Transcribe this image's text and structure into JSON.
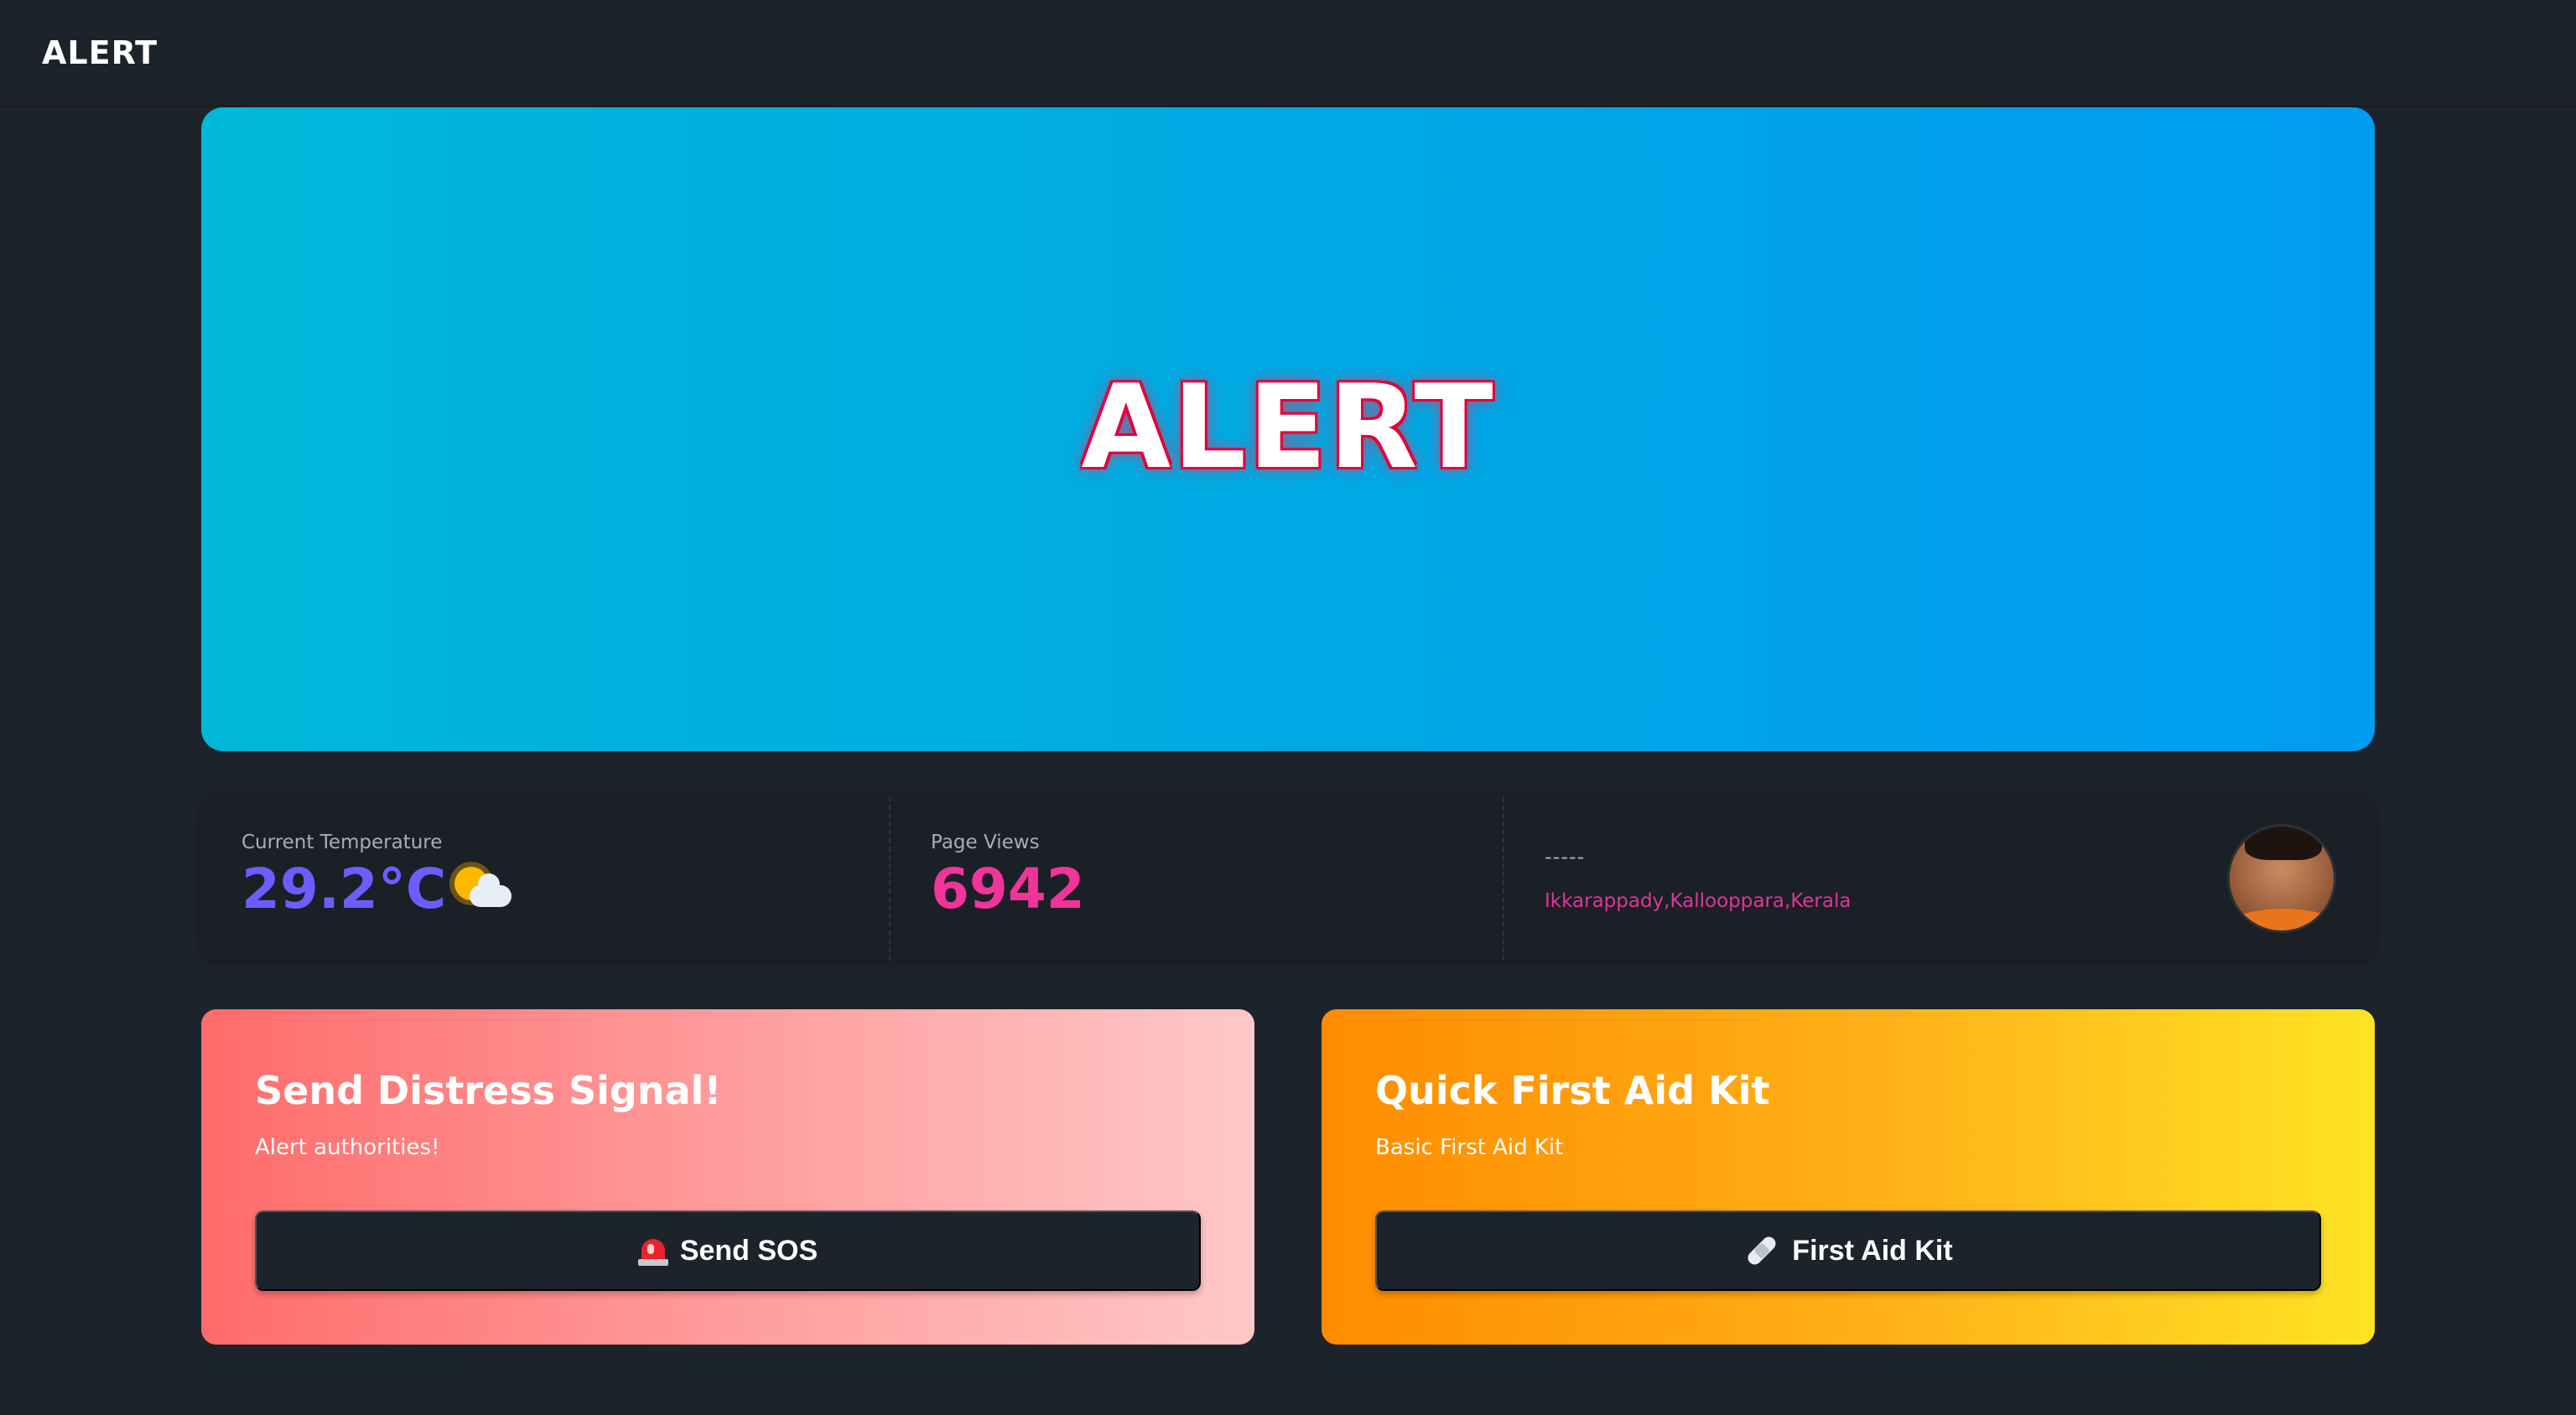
{
  "navbar": {
    "brand": "ALERT"
  },
  "hero": {
    "title": "ALERT"
  },
  "stats": {
    "temperature": {
      "label": "Current Temperature",
      "value": "29.2°C",
      "icon": "sun-behind-cloud-icon"
    },
    "views": {
      "label": "Page Views",
      "value": "6942"
    },
    "location": {
      "dash": "-----",
      "place": "Ikkarappady,Kallooppara,Kerala",
      "avatar": "user-avatar"
    }
  },
  "cards": {
    "sos": {
      "title": "Send Distress Signal!",
      "subtitle": "Alert authorities!",
      "button_label": "Send SOS",
      "button_icon": "siren-icon"
    },
    "first_aid": {
      "title": "Quick First Aid Kit",
      "subtitle": "Basic First Aid Kit",
      "button_label": "First Aid Kit",
      "button_icon": "bandage-icon"
    }
  },
  "colors": {
    "background": "#1d232a",
    "hero_gradient": [
      "#00b8d9",
      "#009cf2"
    ],
    "temperature": "#6c5dff",
    "views": "#f0349a",
    "location": "#e0359a",
    "sos_gradient": [
      "#ff6b6b",
      "#ffc8c8"
    ],
    "aid_gradient": [
      "#ff8c00",
      "#ffe324"
    ]
  }
}
